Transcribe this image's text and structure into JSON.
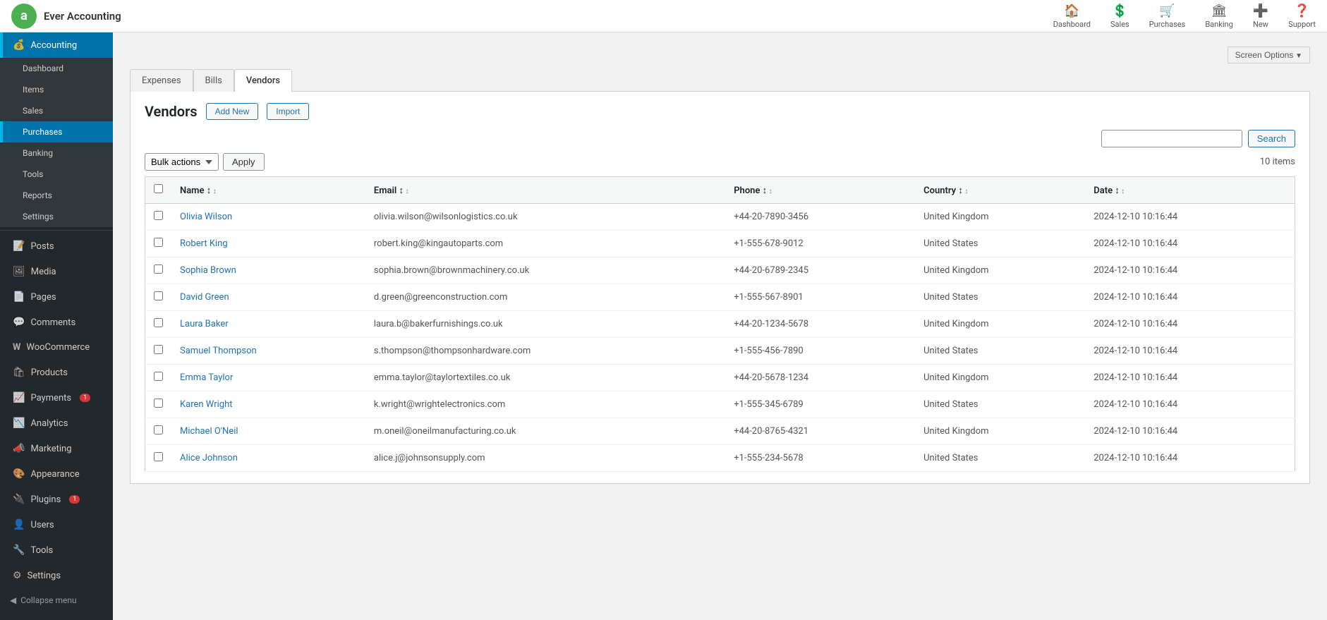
{
  "app": {
    "logo_letter": "a",
    "title": "Ever Accounting"
  },
  "top_nav": [
    {
      "id": "dashboard",
      "label": "Dashboard",
      "icon": "🏠"
    },
    {
      "id": "sales",
      "label": "Sales",
      "icon": "💲"
    },
    {
      "id": "purchases",
      "label": "Purchases",
      "icon": "🛒"
    },
    {
      "id": "banking",
      "label": "Banking",
      "icon": "🏛"
    },
    {
      "id": "new",
      "label": "New",
      "icon": "➕"
    },
    {
      "id": "support",
      "label": "Support",
      "icon": "❓"
    }
  ],
  "screen_options": "Screen Options",
  "sidebar": {
    "accounting_items": [
      {
        "id": "dashboard",
        "label": "Dashboard",
        "icon": "⊞"
      },
      {
        "id": "items",
        "label": "Items",
        "icon": "≡"
      },
      {
        "id": "sales",
        "label": "Sales",
        "icon": "↗"
      },
      {
        "id": "purchases",
        "label": "Purchases",
        "icon": "↙",
        "active": true
      },
      {
        "id": "banking",
        "label": "Banking",
        "icon": "🏦"
      },
      {
        "id": "tools",
        "label": "Tools",
        "icon": "🔧"
      },
      {
        "id": "reports",
        "label": "Reports",
        "icon": "📊"
      },
      {
        "id": "settings",
        "label": "Settings",
        "icon": "⚙"
      }
    ],
    "wp_items": [
      {
        "id": "posts",
        "label": "Posts",
        "icon": "📝"
      },
      {
        "id": "media",
        "label": "Media",
        "icon": "🖼"
      },
      {
        "id": "pages",
        "label": "Pages",
        "icon": "📄"
      },
      {
        "id": "comments",
        "label": "Comments",
        "icon": "💬"
      },
      {
        "id": "woocommerce",
        "label": "WooCommerce",
        "icon": "W"
      },
      {
        "id": "products",
        "label": "Products",
        "icon": "🛍"
      },
      {
        "id": "payments",
        "label": "Payments",
        "icon": "📈",
        "badge": "1"
      },
      {
        "id": "analytics",
        "label": "Analytics",
        "icon": "📉"
      },
      {
        "id": "marketing",
        "label": "Marketing",
        "icon": "📣"
      },
      {
        "id": "appearance",
        "label": "Appearance",
        "icon": "🎨"
      },
      {
        "id": "plugins",
        "label": "Plugins",
        "icon": "🔌",
        "badge": "1"
      },
      {
        "id": "users",
        "label": "Users",
        "icon": "👤"
      },
      {
        "id": "tools",
        "label": "Tools",
        "icon": "🔧"
      },
      {
        "id": "settings",
        "label": "Settings",
        "icon": "⚙"
      }
    ],
    "collapse_label": "Collapse menu"
  },
  "tabs": [
    {
      "id": "expenses",
      "label": "Expenses"
    },
    {
      "id": "bills",
      "label": "Bills"
    },
    {
      "id": "vendors",
      "label": "Vendors",
      "active": true
    }
  ],
  "page": {
    "title": "Vendors",
    "add_new_label": "Add New",
    "import_label": "Import",
    "search_placeholder": "",
    "search_button": "Search",
    "bulk_actions_label": "Bulk actions",
    "apply_label": "Apply",
    "items_count": "10 items"
  },
  "table": {
    "columns": [
      {
        "id": "name",
        "label": "Name",
        "sortable": true
      },
      {
        "id": "email",
        "label": "Email",
        "sortable": true
      },
      {
        "id": "phone",
        "label": "Phone",
        "sortable": true
      },
      {
        "id": "country",
        "label": "Country",
        "sortable": true
      },
      {
        "id": "date",
        "label": "Date",
        "sortable": true
      }
    ],
    "rows": [
      {
        "id": 1,
        "name": "Olivia Wilson",
        "email": "olivia.wilson@wilsonlogistics.co.uk",
        "phone": "+44-20-7890-3456",
        "country": "United Kingdom",
        "date": "2024-12-10 10:16:44"
      },
      {
        "id": 2,
        "name": "Robert King",
        "email": "robert.king@kingautoparts.com",
        "phone": "+1-555-678-9012",
        "country": "United States",
        "date": "2024-12-10 10:16:44"
      },
      {
        "id": 3,
        "name": "Sophia Brown",
        "email": "sophia.brown@brownmachinery.co.uk",
        "phone": "+44-20-6789-2345",
        "country": "United Kingdom",
        "date": "2024-12-10 10:16:44"
      },
      {
        "id": 4,
        "name": "David Green",
        "email": "d.green@greenconstruction.com",
        "phone": "+1-555-567-8901",
        "country": "United States",
        "date": "2024-12-10 10:16:44"
      },
      {
        "id": 5,
        "name": "Laura Baker",
        "email": "laura.b@bakerfurnishings.co.uk",
        "phone": "+44-20-1234-5678",
        "country": "United Kingdom",
        "date": "2024-12-10 10:16:44"
      },
      {
        "id": 6,
        "name": "Samuel Thompson",
        "email": "s.thompson@thompsonhardware.com",
        "phone": "+1-555-456-7890",
        "country": "United States",
        "date": "2024-12-10 10:16:44"
      },
      {
        "id": 7,
        "name": "Emma Taylor",
        "email": "emma.taylor@taylortextiles.co.uk",
        "phone": "+44-20-5678-1234",
        "country": "United Kingdom",
        "date": "2024-12-10 10:16:44"
      },
      {
        "id": 8,
        "name": "Karen Wright",
        "email": "k.wright@wrightelectronics.com",
        "phone": "+1-555-345-6789",
        "country": "United States",
        "date": "2024-12-10 10:16:44"
      },
      {
        "id": 9,
        "name": "Michael O'Neil",
        "email": "m.oneil@oneilmanufacturing.co.uk",
        "phone": "+44-20-8765-4321",
        "country": "United Kingdom",
        "date": "2024-12-10 10:16:44"
      },
      {
        "id": 10,
        "name": "Alice Johnson",
        "email": "alice.j@johnsonsupply.com",
        "phone": "+1-555-234-5678",
        "country": "United States",
        "date": "2024-12-10 10:16:44"
      }
    ]
  }
}
